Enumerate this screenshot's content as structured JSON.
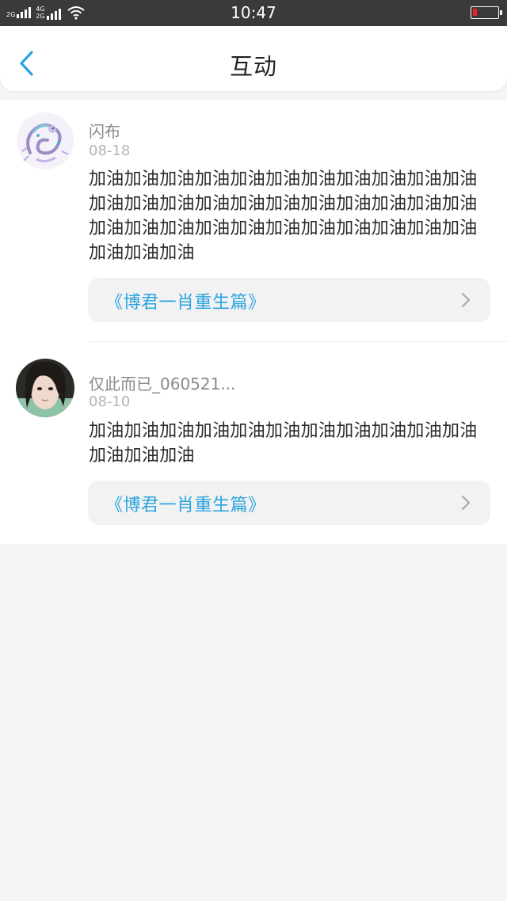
{
  "status_bar": {
    "time": "10:47",
    "net1": "2G",
    "net2_top": "4G",
    "net2_bottom": "2G"
  },
  "header": {
    "title": "互动"
  },
  "comments": [
    {
      "username": "闪布",
      "date": "08-18",
      "text": "加油加油加油加油加油加油加油加油加油加油加油加油加油加油加油加油加油加油加油加油加油加油加油加油加油加油加油加油加油加油加油加油加油加油加油加油",
      "book": "《博君一肖重生篇》"
    },
    {
      "username": "仅此而已_060521...",
      "date": "08-10",
      "text": "加油加油加油加油加油加油加油加油加油加油加油加油加油加油",
      "book": "《博君一肖重生篇》"
    }
  ],
  "colors": {
    "accent": "#2ba4e0",
    "status_bar_bg": "#3a3a3a",
    "battery_low": "#e22222"
  },
  "icons": {
    "back": "chevron-left-icon",
    "book_arrow": "chevron-right-icon",
    "wifi": "wifi-icon",
    "battery": "battery-icon"
  }
}
